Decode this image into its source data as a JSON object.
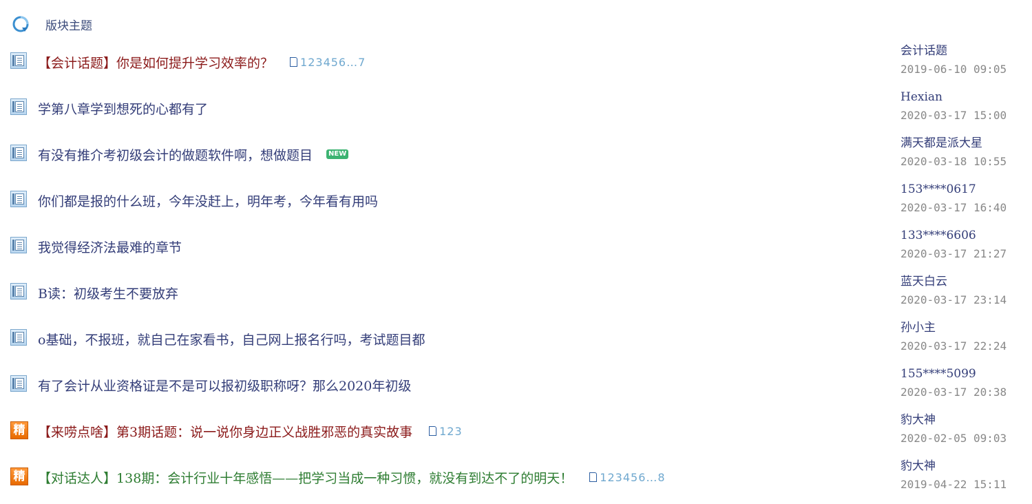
{
  "header": {
    "icon": "refresh-icon",
    "title": "版块主题"
  },
  "colors": {
    "subject_default": "#333d78",
    "subject_red": "#8b1a1a",
    "subject_green": "#2e7d32",
    "pages": "#6fa8cf",
    "time": "#888888",
    "new_badge": "#3cb371",
    "jing_badge": "#e86a00"
  },
  "threads": [
    {
      "icon": "doc-icon",
      "tag": "【会计话题】",
      "title": "你是如何提升学习效率的？",
      "style": "red",
      "pages": "123456…7",
      "badge": "",
      "author": "会计话题",
      "time": "2019-06-10 09:05"
    },
    {
      "icon": "doc-icon",
      "tag": "",
      "title": "学第八章学到想死的心都有了",
      "style": "default",
      "pages": "",
      "badge": "",
      "author": "Hexian",
      "time": "2020-03-17 15:00"
    },
    {
      "icon": "doc-icon",
      "tag": "",
      "title": "有没有推介考初级会计的做题软件啊，想做题目",
      "style": "default",
      "pages": "",
      "badge": "NEW",
      "author": "满天都是派大星",
      "time": "2020-03-18 10:55"
    },
    {
      "icon": "doc-icon",
      "tag": "",
      "title": "你们都是报的什么班，今年没赶上，明年考，今年看有用吗",
      "style": "default",
      "pages": "",
      "badge": "",
      "author": "153****0617",
      "time": "2020-03-17 16:40"
    },
    {
      "icon": "doc-icon",
      "tag": "",
      "title": "我觉得经济法最难的章节",
      "style": "default",
      "pages": "",
      "badge": "",
      "author": "133****6606",
      "time": "2020-03-17 21:27"
    },
    {
      "icon": "doc-icon",
      "tag": "",
      "title": "B读：初级考生不要放弃",
      "style": "default",
      "pages": "",
      "badge": "",
      "author": "蓝天白云",
      "time": "2020-03-17 23:14"
    },
    {
      "icon": "doc-icon",
      "tag": "",
      "title": "o基础，不报班，就自己在家看书，自己网上报名行吗，考试题目都",
      "style": "default",
      "pages": "",
      "badge": "",
      "author": "孙小主",
      "time": "2020-03-17 22:24"
    },
    {
      "icon": "doc-icon",
      "tag": "",
      "title": "有了会计从业资格证是不是可以报初级职称呀？那么2020年初级",
      "style": "default",
      "pages": "",
      "badge": "",
      "author": "155****5099",
      "time": "2020-03-17 20:38"
    },
    {
      "icon": "jing-icon",
      "icon_text": "精",
      "tag": "【来唠点啥】",
      "title": "第3期话题：说一说你身边正义战胜邪恶的真实故事",
      "style": "red",
      "pages": "123",
      "badge": "",
      "author": "豹大神",
      "time": "2020-02-05 09:03"
    },
    {
      "icon": "jing-icon",
      "icon_text": "精",
      "tag": "【对话达人】",
      "title": "138期：会计行业十年感悟——把学习当成一种习惯，就没有到达不了的明天！",
      "style": "green",
      "pages": "123456…8",
      "badge": "",
      "author": "豹大神",
      "time": "2019-04-22 15:11"
    }
  ]
}
